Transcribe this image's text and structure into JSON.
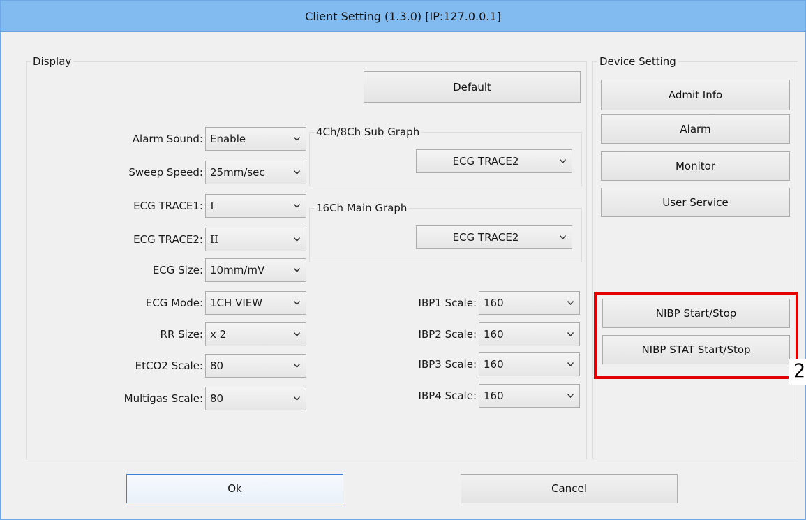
{
  "window": {
    "title": "Client Setting (1.3.0) [IP:127.0.0.1]"
  },
  "display": {
    "group_title": "Display",
    "default_button": "Default",
    "settings": [
      {
        "label": "Alarm Sound:",
        "value": "Enable"
      },
      {
        "label": "Sweep Speed:",
        "value": "25mm/sec"
      },
      {
        "label": "ECG TRACE1:",
        "value": "I"
      },
      {
        "label": "ECG TRACE2:",
        "value": "II"
      },
      {
        "label": "ECG Size:",
        "value": "10mm/mV"
      },
      {
        "label": "ECG Mode:",
        "value": "1CH VIEW"
      },
      {
        "label": "RR Size:",
        "value": "x 2"
      },
      {
        "label": "EtCO2 Scale:",
        "value": "80"
      },
      {
        "label": "Multigas Scale:",
        "value": "80"
      }
    ],
    "sub_graph": {
      "title": "4Ch/8Ch Sub Graph",
      "value": "ECG TRACE2"
    },
    "main_graph": {
      "title": "16Ch Main Graph",
      "value": "ECG TRACE2"
    },
    "ibp": [
      {
        "label": "IBP1 Scale:",
        "value": "160"
      },
      {
        "label": "IBP2 Scale:",
        "value": "160"
      },
      {
        "label": "IBP3 Scale:",
        "value": "160"
      },
      {
        "label": "IBP4 Scale:",
        "value": "160"
      }
    ]
  },
  "device_setting": {
    "group_title": "Device Setting",
    "buttons": [
      "Admit Info",
      "Alarm",
      "Monitor",
      "User Service"
    ],
    "nibp_buttons": [
      "NIBP Start/Stop",
      "NIBP STAT Start/Stop"
    ]
  },
  "annotation": {
    "badge": "2",
    "highlight_color": "#e50000"
  },
  "footer": {
    "ok": "Ok",
    "cancel": "Cancel"
  },
  "icons": {
    "dropdown": "chevron-down-icon"
  }
}
